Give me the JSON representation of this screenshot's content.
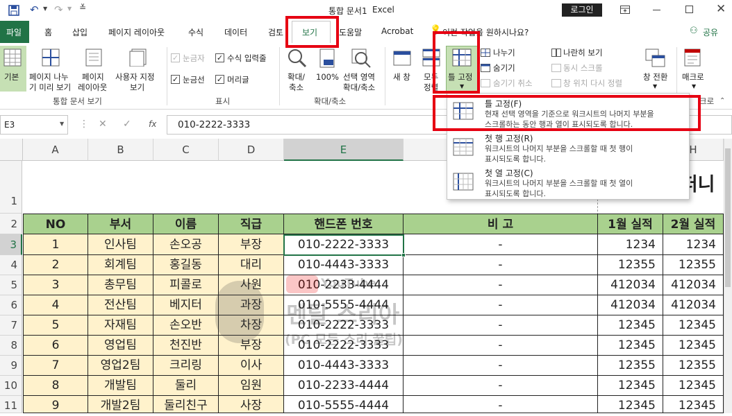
{
  "title": {
    "doc": "통합 문서1",
    "app": "Excel",
    "login": "로그인"
  },
  "tabs": [
    "파일",
    "홈",
    "삽입",
    "페이지 레이아웃",
    "수식",
    "데이터",
    "검토",
    "보기",
    "도움말",
    "Acrobat"
  ],
  "tell_me": "이런 작업을 원하시나요?",
  "share": "공유",
  "ribbon": {
    "workbook_views": {
      "normal": "기본",
      "page_break": [
        "페이지 나누",
        "기 미리 보기"
      ],
      "page_layout": [
        "페이지",
        "레이아웃"
      ],
      "custom": [
        "사용자 지정",
        "보기"
      ],
      "group": "통합 문서 보기"
    },
    "show": {
      "ruler": "눈금자",
      "formula_bar": "수식 입력줄",
      "gridlines": "눈금선",
      "headings": "머리글",
      "group": "표시"
    },
    "zoom": {
      "zoom": [
        "확대/",
        "축소"
      ],
      "hundred": "100%",
      "selection": [
        "선택 영역",
        "확대/축소"
      ],
      "group": "확대/축소"
    },
    "window": {
      "new": "새 창",
      "arrange": [
        "모두",
        "정렬"
      ],
      "freeze": "틀 고정",
      "split": "나누기",
      "hide": "숨기기",
      "unhide": "숨기기 취소",
      "side": "나란히 보기",
      "sync": "동시 스크롤",
      "reset": "창 위치 다시 정렬",
      "switch": [
        "창 전환"
      ],
      "macro": [
        "매크로"
      ],
      "macro_group": "크로"
    }
  },
  "freeze_menu": [
    {
      "title": "틀 고정(F)",
      "desc": [
        "현재 선택 영역을 기준으로 워크시트의 나머지 부분을",
        "스크롤하는 동안 행과 열이 표시되도록 합니다."
      ]
    },
    {
      "title": "첫 행 고정(R)",
      "desc": [
        "워크시트의 나머지 부분을 스크롤할 때 첫 행이",
        "표시되도록 합니다."
      ]
    },
    {
      "title": "첫 열 고정(C)",
      "desc": [
        "워크시트의 나머지 부분을 스크롤할 때 첫 열이",
        "표시되도록 합니다."
      ]
    }
  ],
  "formula_bar": {
    "name_box": "E3",
    "fx": "fx",
    "value": "010-2222-3333"
  },
  "columns": [
    "A",
    "B",
    "C",
    "D",
    "E",
    "H"
  ],
  "rows": [
    "1",
    "2",
    "3",
    "4",
    "5",
    "6",
    "7",
    "8",
    "9",
    "10",
    "11"
  ],
  "sheet": {
    "title_fragment": "컴퍼니",
    "headers": [
      "NO",
      "부서",
      "이름",
      "직급",
      "핸드폰 번호",
      "비 고",
      "1월 실적",
      "2월 실적"
    ],
    "data": [
      [
        "1",
        "인사팀",
        "손오공",
        "부장",
        "010-2222-3333",
        "-",
        "1234",
        "1234"
      ],
      [
        "2",
        "회계팀",
        "홍길동",
        "대리",
        "010-4443-3333",
        "-",
        "12355",
        "12355"
      ],
      [
        "3",
        "총무팀",
        "피콜로",
        "사원",
        "010-2233-4444",
        "-",
        "412034",
        "412034"
      ],
      [
        "4",
        "전산팀",
        "베지터",
        "과장",
        "010-5555-4444",
        "-",
        "412034",
        "412034"
      ],
      [
        "5",
        "자재팀",
        "손오반",
        "차장",
        "010-2222-3333",
        "-",
        "12345",
        "12345"
      ],
      [
        "6",
        "영업팀",
        "천진반",
        "부장",
        "010-2222-3333",
        "-",
        "12345",
        "12345"
      ],
      [
        "7",
        "영업2팀",
        "크리링",
        "이사",
        "010-4443-3333",
        "-",
        "12355",
        "12355"
      ],
      [
        "8",
        "개발팀",
        "둘리",
        "임원",
        "010-2233-4444",
        "-",
        "12345",
        "12345"
      ],
      [
        "9",
        "개발2팀",
        "둘리친구",
        "사장",
        "010-5555-4444",
        "-",
        "12345",
        "12345"
      ]
    ]
  },
  "watermark": [
    "YouTube",
    "멘탈 스리아",
    "(PC 모든 스리 꿀팁)"
  ],
  "colors": {
    "excel_green": "#217346",
    "header_green": "#a9d18e",
    "data_yellow": "#fff2cc",
    "highlight_red": "#e60012"
  }
}
